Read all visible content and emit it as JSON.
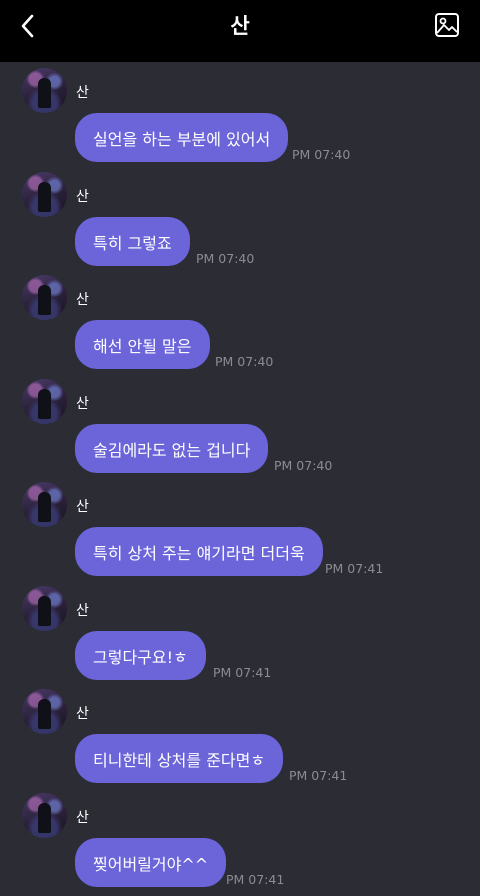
{
  "header": {
    "title": "산"
  },
  "messages": [
    {
      "sender": "산",
      "text": "실언을 하는 부분에 있어서",
      "time": "PM 07:40"
    },
    {
      "sender": "산",
      "text": "특히 그렇죠",
      "time": "PM 07:40"
    },
    {
      "sender": "산",
      "text": "해선 안될 말은",
      "time": "PM 07:40"
    },
    {
      "sender": "산",
      "text": "술김에라도 없는 겁니다",
      "time": "PM 07:40"
    },
    {
      "sender": "산",
      "text": "특히 상처 주는 얘기라면 더더욱",
      "time": "PM 07:41"
    },
    {
      "sender": "산",
      "text": "그렇다구요!ㅎ",
      "time": "PM 07:41"
    },
    {
      "sender": "산",
      "text": "티니한테 상처를 준다면ㅎ",
      "time": "PM 07:41"
    },
    {
      "sender": "산",
      "text": "찢어버릴거야^^",
      "time": "PM 07:41"
    }
  ],
  "colors": {
    "header_bg": "#000000",
    "chat_bg": "#2b2c34",
    "bubble": "#6b65d9",
    "time_text": "#8a8b93"
  },
  "icons": {
    "back": "chevron-left-icon",
    "gallery": "image-gallery-icon"
  }
}
